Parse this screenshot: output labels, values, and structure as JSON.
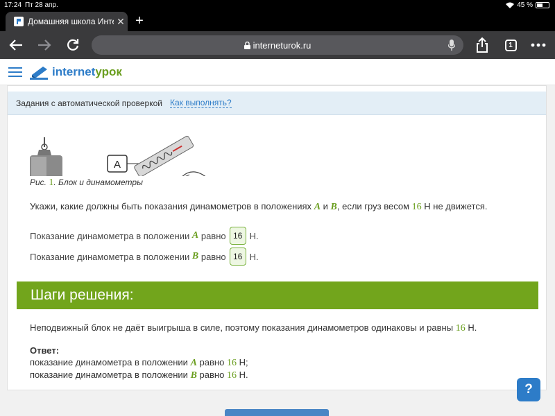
{
  "status": {
    "time": "17:24",
    "date": "Пт 28 апр.",
    "battery": "45 %"
  },
  "browser": {
    "tab_title": "Домашняя школа Интер",
    "url": "interneturok.ru",
    "tab_count": "1"
  },
  "site": {
    "logo_part1": "internet",
    "logo_part2": "урок"
  },
  "notice": {
    "text": "Задания с автоматической проверкой",
    "link": "Как выполнять?"
  },
  "figure": {
    "label": "A",
    "caption_prefix": "Рис.",
    "caption_num": "1",
    "caption_text": ". Блок и динамометры"
  },
  "question": {
    "before": "Укажи, какие должны быть показания динамометров в положениях",
    "var_a": "A",
    "and": "и",
    "var_b": "B",
    "middle": ", если груз весом",
    "weight": "16",
    "after": "Н не движется."
  },
  "answers": [
    {
      "prefix": "Показание динамометра в положении",
      "var": "A",
      "mid": "равно",
      "value": "16",
      "unit": "Н."
    },
    {
      "prefix": "Показание динамометра в положении",
      "var": "B",
      "mid": "равно",
      "value": "16",
      "unit": "Н."
    }
  ],
  "solution": {
    "title": "Шаги решения:",
    "text": "Неподвижный блок не даёт выигрыша в силе, поэтому показания динамометров одинаковы и равны",
    "value": "16",
    "unit": "Н.",
    "answer_label": "Ответ:",
    "lines": [
      {
        "prefix": "показание динамометра в положении",
        "var": "A",
        "mid": "равно",
        "value": "16",
        "unit": "Н;"
      },
      {
        "prefix": "показание динамометра в положении",
        "var": "B",
        "mid": "равно",
        "value": "16",
        "unit": "Н."
      }
    ]
  },
  "help_label": "?"
}
